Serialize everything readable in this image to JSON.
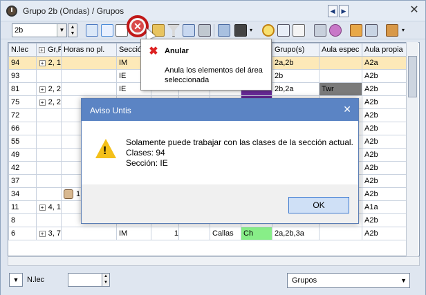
{
  "window": {
    "title": "Grupo 2b (Ondas) / Grupos"
  },
  "toolbar": {
    "class_value": "2b"
  },
  "grid": {
    "headers": [
      "N.lec",
      "Gr,F",
      "Horas no pl.",
      "Secció",
      "",
      "",
      "",
      "",
      "Grupo(s)",
      "Aula espec",
      "Aula propia"
    ],
    "rows": [
      {
        "c0": "94",
        "c1": "2, 1",
        "c2": "",
        "c3": "IM",
        "c4": "",
        "c5": "",
        "c6": "",
        "c7": "",
        "c8": "2a,2b",
        "c9": "",
        "c10": "A2a"
      },
      {
        "c0": "93",
        "c1": "",
        "c2": "",
        "c3": "IE",
        "c4": "",
        "c5": "",
        "c6": "",
        "c7": "",
        "c8": "2b",
        "c9": "",
        "c10": "A2b"
      },
      {
        "c0": "81",
        "c1": "2, 2",
        "c2": "",
        "c3": "IE",
        "c4": "",
        "c5": "",
        "c6": "",
        "c7": "",
        "c8": "2b,2a",
        "c9": "Twr",
        "c10": "A2b"
      },
      {
        "c0": "75",
        "c1": "2, 2",
        "c2": "",
        "c3": "",
        "c4": "",
        "c5": "",
        "c6": "",
        "c7": "",
        "c8": "",
        "c9": "",
        "c10": "A2b"
      },
      {
        "c0": "72",
        "c1": "",
        "c2": "",
        "c3": "",
        "c4": "",
        "c5": "",
        "c6": "",
        "c7": "",
        "c8": "",
        "c9": "",
        "c10": "A2b"
      },
      {
        "c0": "66",
        "c1": "",
        "c2": "",
        "c3": "",
        "c4": "",
        "c5": "",
        "c6": "",
        "c7": "",
        "c8": "",
        "c9": "",
        "c10": "A2b"
      },
      {
        "c0": "55",
        "c1": "",
        "c2": "",
        "c3": "",
        "c4": "",
        "c5": "",
        "c6": "",
        "c7": "",
        "c8": "",
        "c9": "",
        "c10": "A2b"
      },
      {
        "c0": "49",
        "c1": "",
        "c2": "",
        "c3": "",
        "c4": "",
        "c5": "",
        "c6": "",
        "c7": "",
        "c8": "",
        "c9": "",
        "c10": "A2b"
      },
      {
        "c0": "42",
        "c1": "",
        "c2": "",
        "c3": "",
        "c4": "",
        "c5": "",
        "c6": "",
        "c7": "",
        "c8": "",
        "c9": "",
        "c10": "A2b"
      },
      {
        "c0": "37",
        "c1": "",
        "c2": "",
        "c3": "",
        "c4": "",
        "c5": "",
        "c6": "",
        "c7": "",
        "c8": "",
        "c9": "",
        "c10": "A2b"
      },
      {
        "c0": "34",
        "c1": "",
        "c2": "1",
        "c3": "",
        "c4": "",
        "c5": "",
        "c6": "",
        "c7": "",
        "c8": "",
        "c9": "",
        "c10": "A2b"
      },
      {
        "c0": "11",
        "c1": "4, 1",
        "c2": "",
        "c3": "",
        "c4": "",
        "c5": "",
        "c6": "",
        "c7": "",
        "c8": "",
        "c9": "",
        "c10": "A1a"
      },
      {
        "c0": "8",
        "c1": "",
        "c2": "",
        "c3": "",
        "c4": "",
        "c5": "",
        "c6": "",
        "c7": "",
        "c8": "",
        "c9": "",
        "c10": "A2b"
      },
      {
        "c0": "6",
        "c1": "3, 7",
        "c2": "",
        "c3": "IM",
        "c4": "1",
        "c5": "",
        "c6": "Callas",
        "c7": "Ch",
        "c8": "2a,2b,3a",
        "c9": "",
        "c10": "A2b"
      }
    ]
  },
  "tooltip": {
    "title": "Anular",
    "body": "Anula los elementos del área seleccionada"
  },
  "dialog": {
    "title": "Aviso Untis",
    "line1": "Solamente puede trabajar con las clases de la sección actual.",
    "line2": "Clases: 94",
    "line3": "Sección: IE",
    "ok_label": "OK"
  },
  "bottom": {
    "label": "N.lec",
    "select_value": "Grupos"
  },
  "colors": {
    "selected_row": "#fde9b8",
    "dialog_title": "#5b84c4",
    "twr_cell": "#7a7a7a",
    "ch_cell": "#88ee88",
    "violet_cell": "#6a2a9a"
  }
}
